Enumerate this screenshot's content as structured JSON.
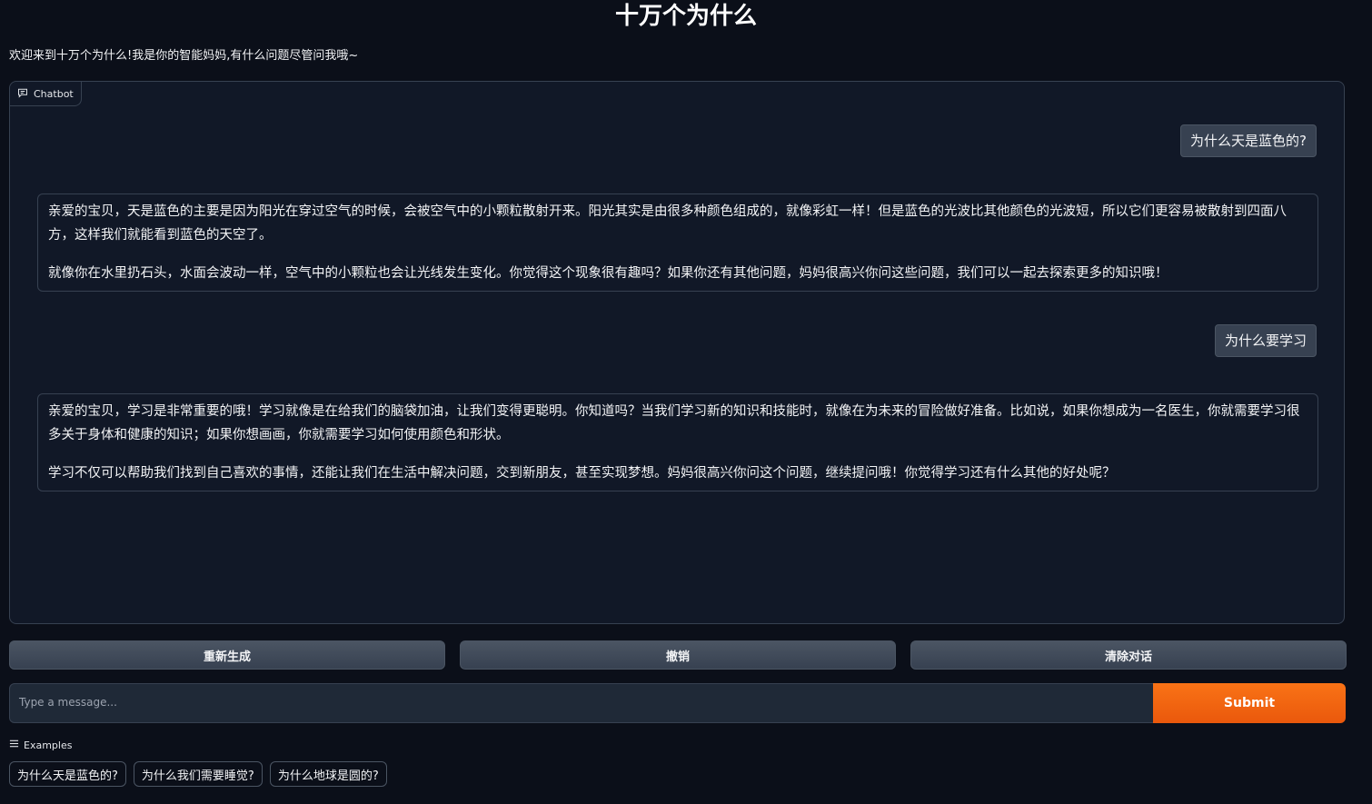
{
  "app": {
    "title": "十万个为什么",
    "description": "欢迎来到十万个为什么!我是你的智能妈妈,有什么问题尽管问我哦~"
  },
  "chatbot": {
    "label": "Chatbot",
    "icon": "chat-icon",
    "messages": [
      {
        "role": "user",
        "text": "为什么天是蓝色的?"
      },
      {
        "role": "bot",
        "paragraphs": [
          "亲爱的宝贝，天是蓝色的主要是因为阳光在穿过空气的时候，会被空气中的小颗粒散射开来。阳光其实是由很多种颜色组成的，就像彩虹一样！但是蓝色的光波比其他颜色的光波短，所以它们更容易被散射到四面八方，这样我们就能看到蓝色的天空了。",
          "就像你在水里扔石头，水面会波动一样，空气中的小颗粒也会让光线发生变化。你觉得这个现象很有趣吗？如果你还有其他问题，妈妈很高兴你问这些问题，我们可以一起去探索更多的知识哦！"
        ]
      },
      {
        "role": "user",
        "text": "为什么要学习"
      },
      {
        "role": "bot",
        "paragraphs": [
          "亲爱的宝贝，学习是非常重要的哦！学习就像是在给我们的脑袋加油，让我们变得更聪明。你知道吗？当我们学习新的知识和技能时，就像在为未来的冒险做好准备。比如说，如果你想成为一名医生，你就需要学习很多关于身体和健康的知识；如果你想画画，你就需要学习如何使用颜色和形状。",
          "学习不仅可以帮助我们找到自己喜欢的事情，还能让我们在生活中解决问题，交到新朋友，甚至实现梦想。妈妈很高兴你问这个问题，继续提问哦！你觉得学习还有什么其他的好处呢？"
        ]
      }
    ]
  },
  "buttons": {
    "regenerate": "重新生成",
    "undo": "撤销",
    "clear": "清除对话"
  },
  "input": {
    "placeholder": "Type a message...",
    "value": ""
  },
  "submit_label": "Submit",
  "examples": {
    "label": "Examples",
    "icon": "list-icon",
    "items": [
      "为什么天是蓝色的?",
      "为什么我们需要睡觉?",
      "为什么地球是圆的?"
    ]
  },
  "colors": {
    "background": "#0b0f19",
    "panel": "#111827",
    "accent": "#f97316",
    "border": "#374151"
  }
}
